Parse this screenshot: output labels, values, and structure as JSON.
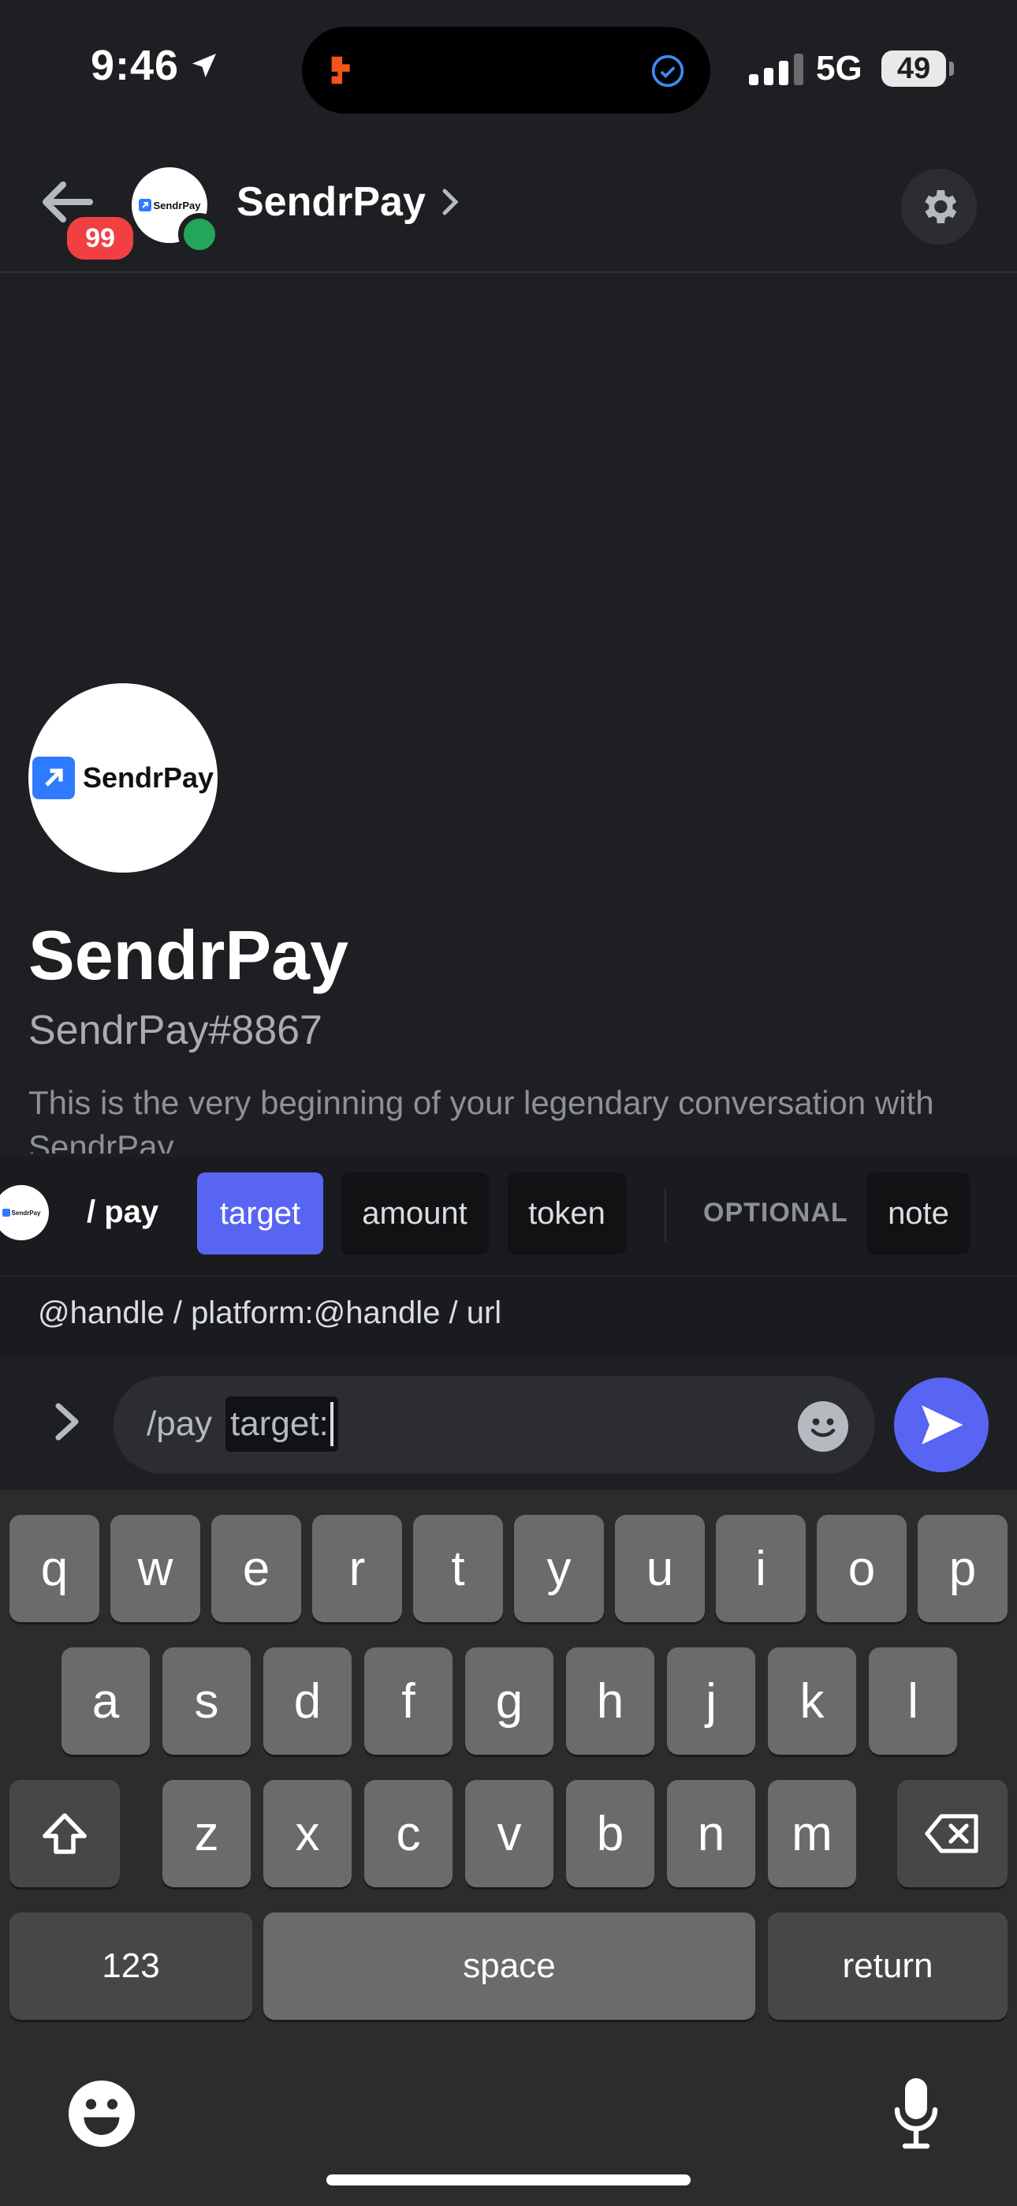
{
  "status_bar": {
    "time": "9:46",
    "network": "5G",
    "battery": "49"
  },
  "header": {
    "unread_badge": "99",
    "title": "SendrPay"
  },
  "logo": {
    "text": "SendrPay"
  },
  "profile": {
    "name": "SendrPay",
    "tag": "SendrPay#8867",
    "intro": "This is the very beginning of your legendary conversation with SendrPay."
  },
  "command": {
    "name": "/ pay",
    "options": [
      {
        "label": "target",
        "active": true
      },
      {
        "label": "amount",
        "active": false
      },
      {
        "label": "token",
        "active": false
      }
    ],
    "optional_label": "OPTIONAL",
    "optional_options": [
      {
        "label": "note"
      }
    ],
    "hint": "@handle / platform:@handle / url"
  },
  "input": {
    "prefix": "/pay",
    "value": "target:"
  },
  "keyboard": {
    "row1": [
      "q",
      "w",
      "e",
      "r",
      "t",
      "y",
      "u",
      "i",
      "o",
      "p"
    ],
    "row2": [
      "a",
      "s",
      "d",
      "f",
      "g",
      "h",
      "j",
      "k",
      "l"
    ],
    "row3": [
      "z",
      "x",
      "c",
      "v",
      "b",
      "n",
      "m"
    ],
    "numbers": "123",
    "space": "space",
    "return": "return"
  },
  "colors": {
    "accent": "#5865f2",
    "background": "#1e1f22",
    "online": "#23a55a",
    "badge": "#f23f42"
  }
}
